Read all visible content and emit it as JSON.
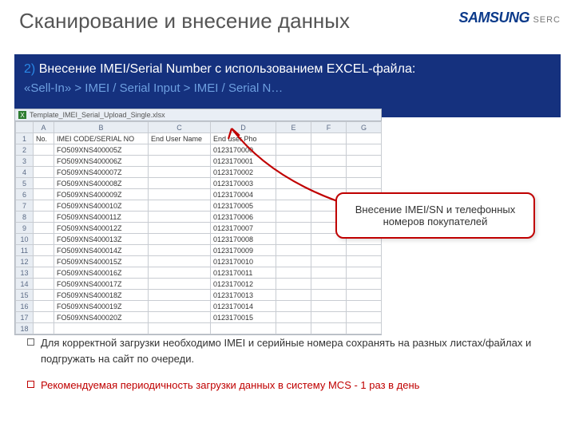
{
  "title": "Сканирование и внесение данных",
  "logo": {
    "brand": "SAMSUNG",
    "suffix": "SERC"
  },
  "bluebar": {
    "num": "2)",
    "text": "Внесение IMEI/Serial Number с использованием EXCEL-файла:",
    "sub": "«Sell-In» > IMEI / Serial Input > IMEI / Serial N…"
  },
  "excel": {
    "tabname": "Template_IMEI_Serial_Upload_Single.xlsx",
    "cols": [
      "",
      "A",
      "B",
      "C",
      "D",
      "E",
      "F",
      "G"
    ],
    "headerRow": {
      "r": "1",
      "A": "No.",
      "B": "IMEI CODE/SERIAL NO",
      "C": "End User Name",
      "D": "End user Pho"
    },
    "rows": [
      {
        "r": "2",
        "B": "FO509XNS400005Z",
        "D": "0123170000"
      },
      {
        "r": "3",
        "B": "FO509XNS400006Z",
        "D": "0123170001"
      },
      {
        "r": "4",
        "B": "FO509XNS400007Z",
        "D": "0123170002"
      },
      {
        "r": "5",
        "B": "FO509XNS400008Z",
        "D": "0123170003"
      },
      {
        "r": "6",
        "B": "FO509XNS400009Z",
        "D": "0123170004"
      },
      {
        "r": "7",
        "B": "FO509XNS400010Z",
        "D": "0123170005"
      },
      {
        "r": "8",
        "B": "FO509XNS400011Z",
        "D": "0123170006"
      },
      {
        "r": "9",
        "B": "FO509XNS400012Z",
        "D": "0123170007"
      },
      {
        "r": "10",
        "B": "FO509XNS400013Z",
        "D": "0123170008"
      },
      {
        "r": "11",
        "B": "FO509XNS400014Z",
        "D": "0123170009"
      },
      {
        "r": "12",
        "B": "FO509XNS400015Z",
        "D": "0123170010"
      },
      {
        "r": "13",
        "B": "FO509XNS400016Z",
        "D": "0123170011"
      },
      {
        "r": "14",
        "B": "FO509XNS400017Z",
        "D": "0123170012"
      },
      {
        "r": "15",
        "B": "FO509XNS400018Z",
        "D": "0123170013"
      },
      {
        "r": "16",
        "B": "FO509XNS400019Z",
        "D": "0123170014"
      },
      {
        "r": "17",
        "B": "FO509XNS400020Z",
        "D": "0123170015"
      },
      {
        "r": "18",
        "B": "",
        "D": ""
      }
    ]
  },
  "callout": "Внесение IMEI/SN и телефонных номеров покупателей",
  "bullets": {
    "b1": "Для корректной загрузки необходимо IMEI и серийные номера сохранять на разных листах/файлах и подгружать на сайт по очереди.",
    "b2": "Рекомендуемая периодичность загрузки данных в систему MCS - 1 раз в день"
  }
}
